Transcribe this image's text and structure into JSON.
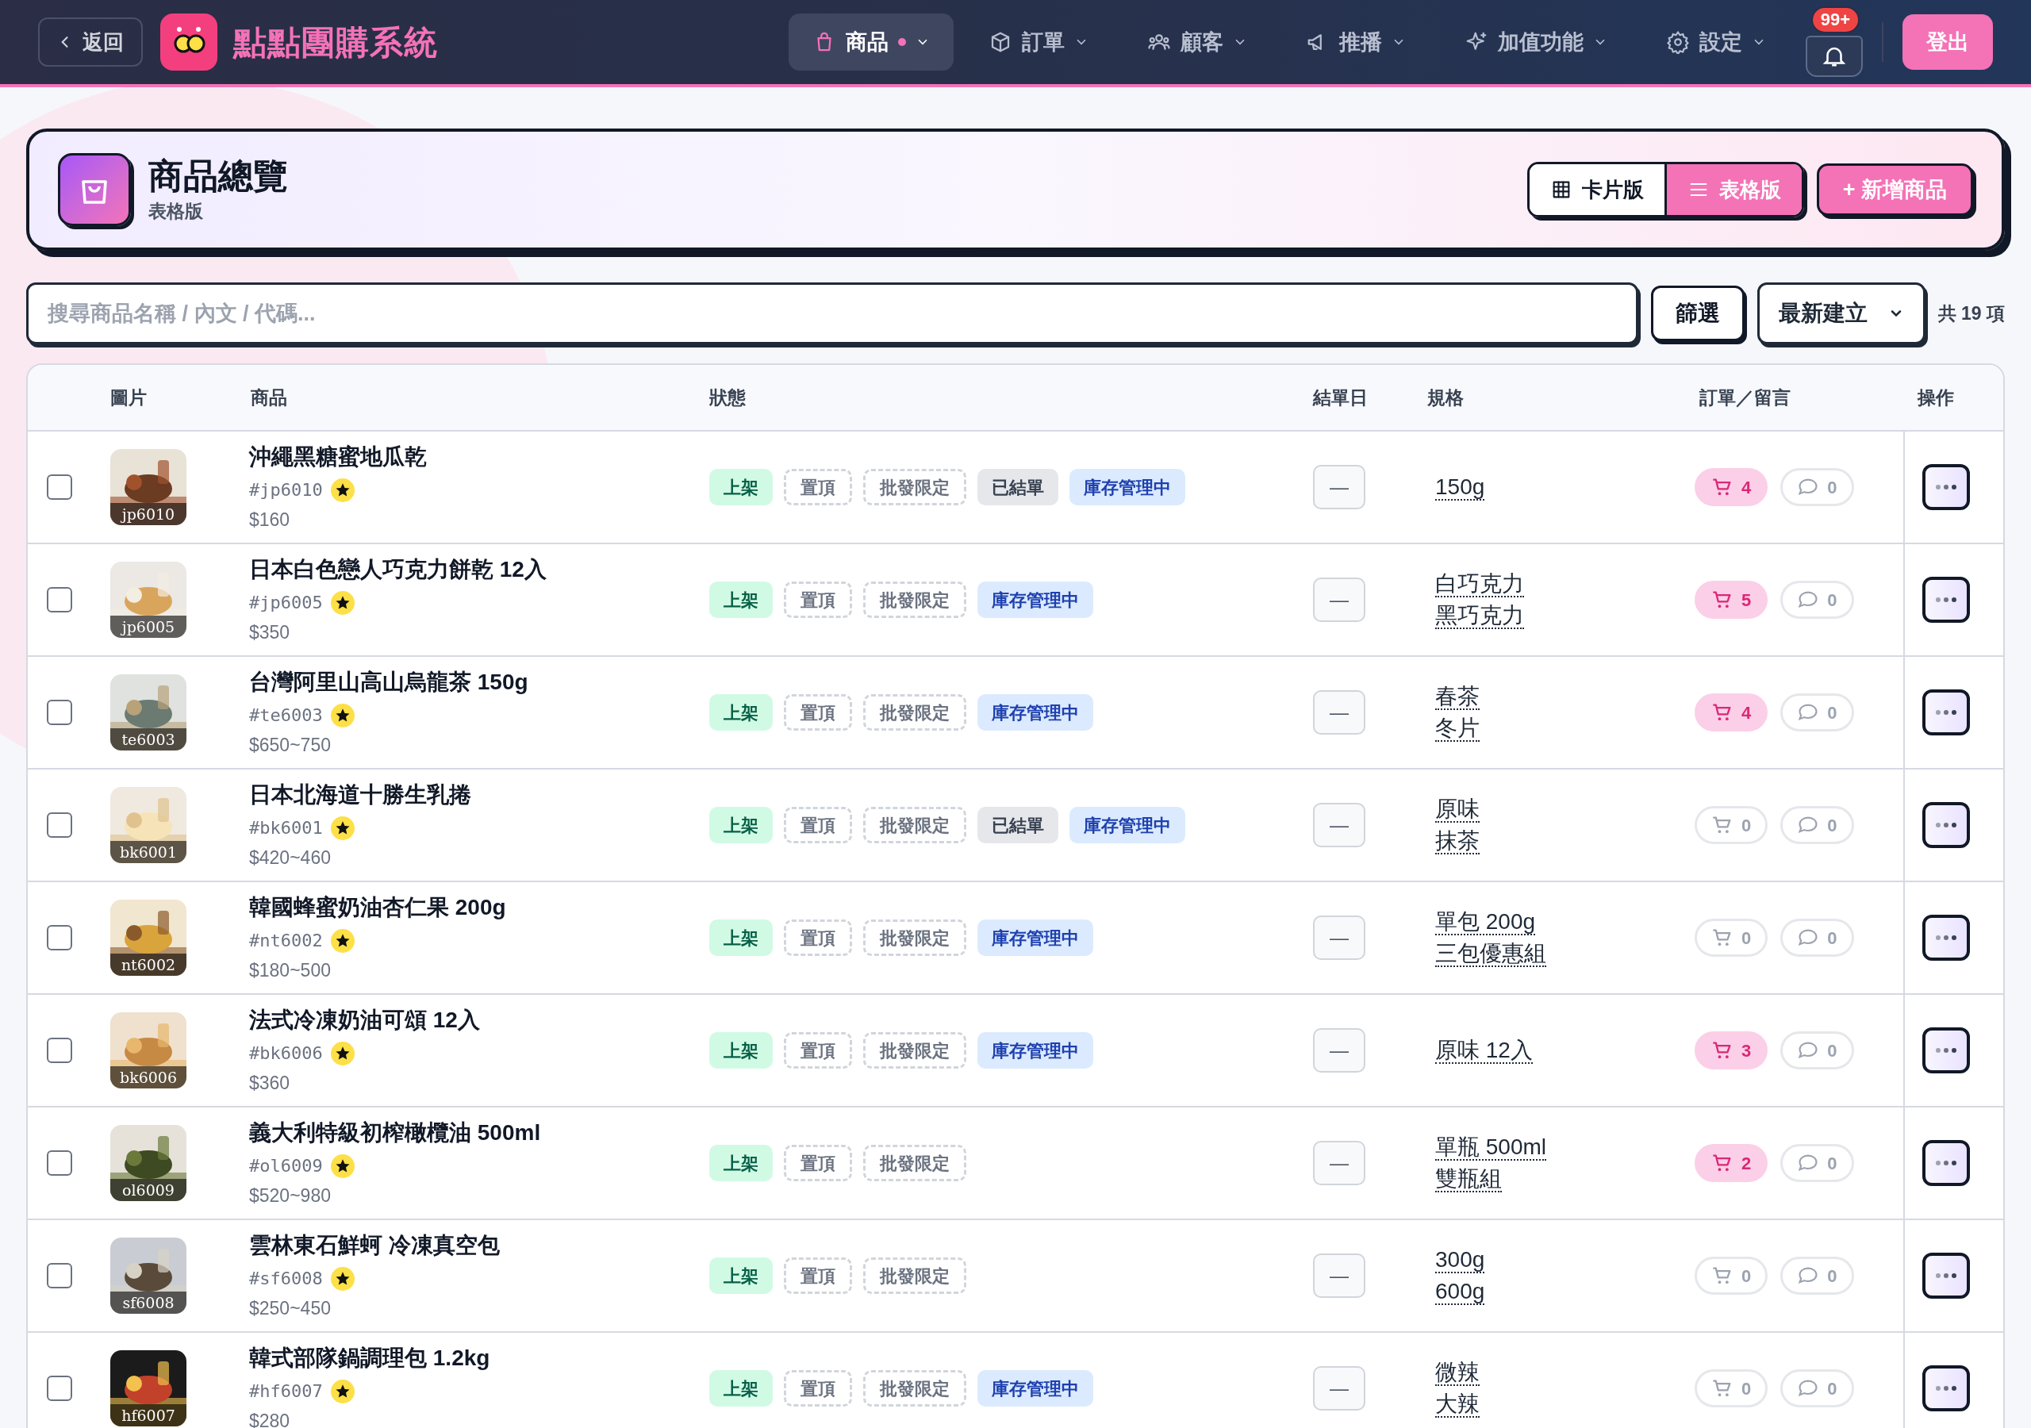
{
  "header": {
    "back_label": "返回",
    "app_title": "點點團購系統",
    "nav": [
      {
        "label": "商品",
        "selected": true,
        "dot": true
      },
      {
        "label": "訂單",
        "selected": false,
        "dot": false
      },
      {
        "label": "顧客",
        "selected": false,
        "dot": false
      },
      {
        "label": "推播",
        "selected": false,
        "dot": false
      },
      {
        "label": "加值功能",
        "selected": false,
        "dot": false
      },
      {
        "label": "設定",
        "selected": false,
        "dot": false
      }
    ],
    "notification_badge": "99+",
    "logout_label": "登出"
  },
  "page": {
    "title": "商品總覽",
    "subtitle": "表格版",
    "views": [
      {
        "label": "卡片版",
        "selected": false
      },
      {
        "label": "表格版",
        "selected": true
      }
    ],
    "add_button": "+ 新增商品"
  },
  "toolbar": {
    "search": {
      "placeholder": "搜尋商品名稱 / 內文 / 代碼..."
    },
    "filter_label": "篩選",
    "sort": "最新建立",
    "count": "共 19 項"
  },
  "table": {
    "columns": [
      "圖片",
      "商品",
      "狀態",
      "結單日",
      "規格",
      "訂單／留言",
      "操作"
    ],
    "rows": [
      {
        "checked": false,
        "code_label": "jp6010",
        "name": "沖繩黑糖蜜地瓜乾",
        "code": "#jp6010",
        "price": "$160",
        "tags": [
          {
            "label": "上架",
            "kind": "listed"
          },
          {
            "label": "置頂",
            "kind": "dashed"
          },
          {
            "label": "批發限定",
            "kind": "dashed"
          },
          {
            "label": "已結單",
            "kind": "closed"
          },
          {
            "label": "庫存管理中",
            "kind": "stock"
          }
        ],
        "deadline": "—",
        "specs": [
          "150g"
        ],
        "orders": "4",
        "has_orders": true,
        "comments": "0"
      },
      {
        "checked": false,
        "code_label": "jp6005",
        "name": "日本白色戀人巧克力餅乾 12入",
        "code": "#jp6005",
        "price": "$350",
        "tags": [
          {
            "label": "上架",
            "kind": "listed"
          },
          {
            "label": "置頂",
            "kind": "dashed"
          },
          {
            "label": "批發限定",
            "kind": "dashed"
          },
          {
            "label": "庫存管理中",
            "kind": "stock"
          }
        ],
        "deadline": "—",
        "specs": [
          "白巧克力",
          "黑巧克力"
        ],
        "orders": "5",
        "has_orders": true,
        "comments": "0"
      },
      {
        "checked": false,
        "code_label": "te6003",
        "name": "台灣阿里山高山烏龍茶 150g",
        "code": "#te6003",
        "price": "$650~750",
        "tags": [
          {
            "label": "上架",
            "kind": "listed"
          },
          {
            "label": "置頂",
            "kind": "dashed"
          },
          {
            "label": "批發限定",
            "kind": "dashed"
          },
          {
            "label": "庫存管理中",
            "kind": "stock"
          }
        ],
        "deadline": "—",
        "specs": [
          "春茶",
          "冬片"
        ],
        "orders": "4",
        "has_orders": true,
        "comments": "0"
      },
      {
        "checked": false,
        "code_label": "bk6001",
        "name": "日本北海道十勝生乳捲",
        "code": "#bk6001",
        "price": "$420~460",
        "tags": [
          {
            "label": "上架",
            "kind": "listed"
          },
          {
            "label": "置頂",
            "kind": "dashed"
          },
          {
            "label": "批發限定",
            "kind": "dashed"
          },
          {
            "label": "已結單",
            "kind": "closed"
          },
          {
            "label": "庫存管理中",
            "kind": "stock"
          }
        ],
        "deadline": "—",
        "specs": [
          "原味",
          "抹茶"
        ],
        "orders": "0",
        "has_orders": false,
        "comments": "0"
      },
      {
        "checked": false,
        "code_label": "nt6002",
        "name": "韓國蜂蜜奶油杏仁果 200g",
        "code": "#nt6002",
        "price": "$180~500",
        "tags": [
          {
            "label": "上架",
            "kind": "listed"
          },
          {
            "label": "置頂",
            "kind": "dashed"
          },
          {
            "label": "批發限定",
            "kind": "dashed"
          },
          {
            "label": "庫存管理中",
            "kind": "stock"
          }
        ],
        "deadline": "—",
        "specs": [
          "單包 200g",
          "三包優惠組"
        ],
        "orders": "0",
        "has_orders": false,
        "comments": "0"
      },
      {
        "checked": false,
        "code_label": "bk6006",
        "name": "法式冷凍奶油可頌 12入",
        "code": "#bk6006",
        "price": "$360",
        "tags": [
          {
            "label": "上架",
            "kind": "listed"
          },
          {
            "label": "置頂",
            "kind": "dashed"
          },
          {
            "label": "批發限定",
            "kind": "dashed"
          },
          {
            "label": "庫存管理中",
            "kind": "stock"
          }
        ],
        "deadline": "—",
        "specs": [
          "原味 12入"
        ],
        "orders": "3",
        "has_orders": true,
        "comments": "0"
      },
      {
        "checked": false,
        "code_label": "ol6009",
        "name": "義大利特級初榨橄欖油 500ml",
        "code": "#ol6009",
        "price": "$520~980",
        "tags": [
          {
            "label": "上架",
            "kind": "listed"
          },
          {
            "label": "置頂",
            "kind": "dashed"
          },
          {
            "label": "批發限定",
            "kind": "dashed"
          }
        ],
        "deadline": "—",
        "specs": [
          "單瓶 500ml",
          "雙瓶組"
        ],
        "orders": "2",
        "has_orders": true,
        "comments": "0"
      },
      {
        "checked": false,
        "code_label": "sf6008",
        "name": "雲林東石鮮蚵 冷凍真空包",
        "code": "#sf6008",
        "price": "$250~450",
        "tags": [
          {
            "label": "上架",
            "kind": "listed"
          },
          {
            "label": "置頂",
            "kind": "dashed"
          },
          {
            "label": "批發限定",
            "kind": "dashed"
          }
        ],
        "deadline": "—",
        "specs": [
          "300g",
          "600g"
        ],
        "orders": "0",
        "has_orders": false,
        "comments": "0"
      },
      {
        "checked": false,
        "code_label": "hf6007",
        "name": "韓式部隊鍋調理包 1.2kg",
        "code": "#hf6007",
        "price": "$280",
        "tags": [
          {
            "label": "上架",
            "kind": "listed"
          },
          {
            "label": "置頂",
            "kind": "dashed"
          },
          {
            "label": "批發限定",
            "kind": "dashed"
          },
          {
            "label": "庫存管理中",
            "kind": "stock"
          }
        ],
        "deadline": "—",
        "specs": [
          "微辣",
          "大辣"
        ],
        "orders": "0",
        "has_orders": false,
        "comments": "0"
      }
    ]
  }
}
